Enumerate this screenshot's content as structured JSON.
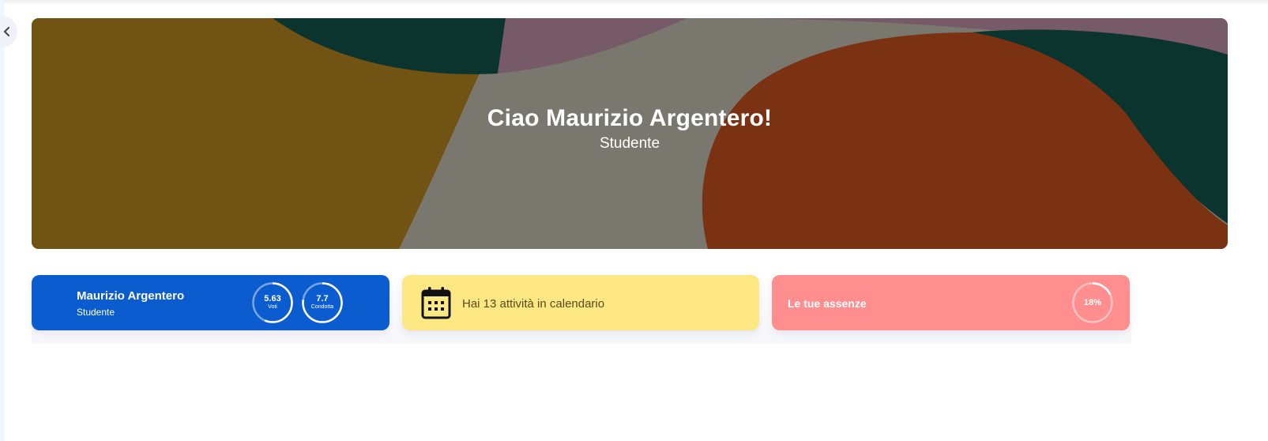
{
  "hero": {
    "greeting": "Ciao Maurizio Argentero!",
    "role": "Studente",
    "colors": {
      "ochre": "#715314",
      "gray": "#7a776e",
      "rust": "#7b3213",
      "teal": "#0b342f",
      "mauve": "#775a67"
    }
  },
  "profile_card": {
    "name": "Maurizio Argentero",
    "role": "Studente",
    "color": "#0b5ccf",
    "grades": {
      "value": "5.63",
      "label": "Voti"
    },
    "conduct": {
      "value": "7.7",
      "label": "Condotta"
    }
  },
  "calendar_card": {
    "icon": "calendar-icon",
    "text": "Hai 13 attività in calendario",
    "color": "#fde883"
  },
  "absences_card": {
    "title": "Le tue assenze",
    "percent": "18%",
    "percent_value": 0.18,
    "color": "#ff8e8e"
  },
  "sidebar": {
    "toggle_icon": "chevron-left-icon"
  }
}
